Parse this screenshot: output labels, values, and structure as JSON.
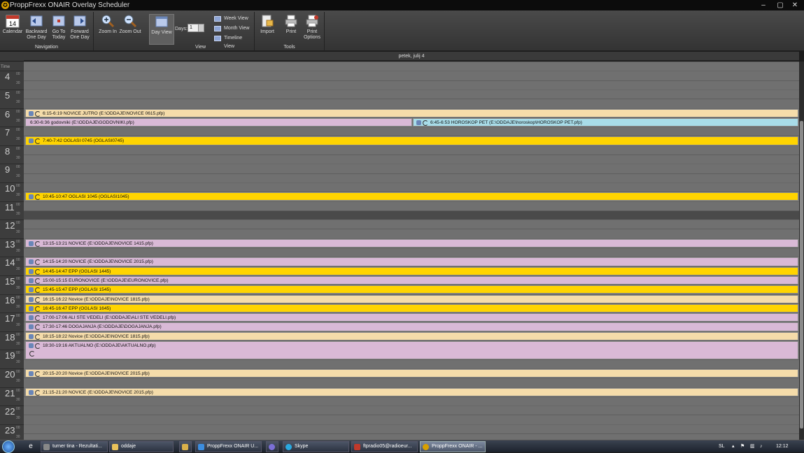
{
  "window": {
    "title": "ProppFrexx ONAIR Overlay Scheduler"
  },
  "ribbon": {
    "navigation": {
      "label": "Navigation",
      "buttons": [
        {
          "label1": "Calendar",
          "label2": ""
        },
        {
          "label1": "Backward",
          "label2": "One Day"
        },
        {
          "label1": "Go To",
          "label2": "Today"
        },
        {
          "label1": "Forward",
          "label2": "One Day"
        }
      ]
    },
    "zoom": {
      "buttons": [
        {
          "label1": "Zoom In"
        },
        {
          "label1": "Zoom Out"
        }
      ]
    },
    "view": {
      "label": "View",
      "day_view": "Day View",
      "days_label": "Days:",
      "days_value": "1",
      "week_view": "Week View",
      "month_view": "Month View",
      "timeline_view": "Timeline View"
    },
    "tools": {
      "label": "Tools",
      "import": "Import",
      "print": "Print",
      "print_options1": "Print",
      "print_options2": "Options"
    },
    "calendar_day": "14"
  },
  "date_header": "petek, julij 4",
  "time_label": "Time",
  "minute_labels": {
    "m00": "00",
    "m30": "30"
  },
  "hours": [
    "4",
    "5",
    "6",
    "7",
    "8",
    "9",
    "10",
    "11",
    "12",
    "13",
    "14",
    "15",
    "16",
    "17",
    "18",
    "19",
    "20",
    "21",
    "22",
    "23"
  ],
  "events": [
    {
      "text": "6:15-6:19 NOVICE JUTRO (E:\\ODDAJE\\NOVICE 0615.pfp)",
      "color": "#f5dcaa",
      "row": 5,
      "span": 1,
      "icons": true
    },
    {
      "text": "6:30-6:36 godovniki (E:\\ODDAJE\\GODOVNIKI.pfp)",
      "color": "#d9b9d6",
      "row": 6,
      "span": 1,
      "icons": false,
      "half": "left"
    },
    {
      "text": "6:45-6:53 HOROSKOP PET (E:\\ODDAJE\\horoskop\\HOROSKOP PET.pfp)",
      "color": "#a8dce8",
      "row": 6,
      "span": 1,
      "icons": true,
      "half": "right"
    },
    {
      "text": "7:40-7:42 OGLASI 0745 (OGLASI0745)",
      "color": "#ffd400",
      "row": 8,
      "span": 1,
      "icons": true
    },
    {
      "text": "10:45-10:47 OGLASI 1045 (OGLASI1045)",
      "color": "#ffd400",
      "row": 14,
      "span": 1,
      "icons": true
    },
    {
      "text": "13:15-13:21 NOVICE (E:\\ODDAJE\\NOVICE 1415.pfp)",
      "color": "#d9b9d6",
      "row": 19,
      "span": 1,
      "icons": true
    },
    {
      "text": "14:15-14:20 NOVICE (E:\\ODDAJE\\NOVICE 2015.pfp)",
      "color": "#d9b9d6",
      "row": 21,
      "span": 1,
      "icons": true
    },
    {
      "text": "14:45-14:47 EPP (OGLASI 1445)",
      "color": "#ffd400",
      "row": 22,
      "span": 1,
      "icons": true
    },
    {
      "text": "15:00-15:15 EURONOVICE (E:\\ODDAJE\\EURONOVICE.pfp)",
      "color": "#d9b9d6",
      "row": 23,
      "span": 1,
      "icons": true
    },
    {
      "text": "15:45-15:47 EPP (OGLASI 1545)",
      "color": "#ffd400",
      "row": 24,
      "span": 1,
      "icons": true
    },
    {
      "text": "16:15-16:22 Novice (E:\\ODDAJE\\NOVICE 1815.pfp)",
      "color": "#f5dcaa",
      "row": 25,
      "span": 1,
      "icons": true
    },
    {
      "text": "16:45-16:47 EPP (OGLASI 1645)",
      "color": "#ffd400",
      "row": 26,
      "span": 1,
      "icons": true
    },
    {
      "text": "17:00-17:06 ALI STE VEDELI (E:\\ODDAJE\\ALI STE VEDELI.pfp)",
      "color": "#d9b9d6",
      "row": 27,
      "span": 1,
      "icons": true
    },
    {
      "text": "17:30-17:46 DOGAJANJA (E:\\ODDAJE\\DOGAJANJA.pfp)",
      "color": "#d9b9d6",
      "row": 28,
      "span": 1,
      "icons": true
    },
    {
      "text": "18:15-18:22 Novice (E:\\ODDAJE\\NOVICE 1815.pfp)",
      "color": "#f5dcaa",
      "row": 29,
      "span": 1,
      "icons": true
    },
    {
      "text": "18:30-19:16 AKTUALNO (E:\\ODDAJE\\AKTUALNO.pfp)",
      "color": "#d9b9d6",
      "row": 30,
      "span": 2,
      "icons": true
    },
    {
      "text": "20:15-20:20 Novice  (E:\\ODDAJE\\NOVICE 2015.pfp)",
      "color": "#f5dcaa",
      "row": 33,
      "span": 1,
      "icons": true
    },
    {
      "text": "21:15-21:20 NOVICE (E:\\ODDAJE\\NOVICE 2015.pfp)",
      "color": "#f5dcaa",
      "row": 35,
      "span": 1,
      "icons": true
    }
  ],
  "taskbar": {
    "tasks": [
      "turner tina - Rezultati...",
      "oddaje",
      "",
      "ProppFrexx ONAIR U...",
      "",
      "Skype",
      "ftpradio05@radioeur...",
      "ProppFrexx ONAIR - ..."
    ],
    "lang": "SL",
    "clock": "12:12"
  }
}
